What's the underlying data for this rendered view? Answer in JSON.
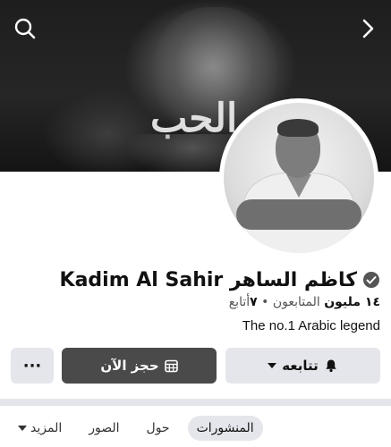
{
  "cover": {
    "logo_text": "الحب"
  },
  "header": {
    "search_icon": "search-icon",
    "next_icon": "chevron-right-icon"
  },
  "profile": {
    "name": "Kadim Al Sahir كاظم الساهر",
    "verified": true,
    "followers_count": "١٤ مليون",
    "followers_label": "المتابعون",
    "separator": "•",
    "following_count": "٧",
    "following_label": "أتابع",
    "bio": "The no.1 Arabic legend"
  },
  "actions": {
    "follow_label": "تتابعه",
    "book_label": "حجز الآن",
    "more_label": "···"
  },
  "tabs": [
    {
      "label": "المنشورات",
      "active": true
    },
    {
      "label": "حول",
      "active": false
    },
    {
      "label": "الصور",
      "active": false
    },
    {
      "label": "المزيد",
      "active": false
    }
  ],
  "colors": {
    "button_gray": "#e4e6eb",
    "button_dark": "#4a4a4a"
  }
}
